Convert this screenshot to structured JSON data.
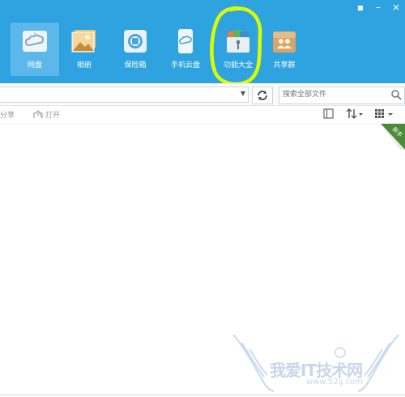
{
  "window": {
    "controls": [
      "pin-icon",
      "minimize-icon",
      "close-icon"
    ]
  },
  "nav": {
    "items": [
      {
        "label": "网盘",
        "icon": "cloud-disk-icon",
        "active": true
      },
      {
        "label": "相册",
        "icon": "photo-album-icon",
        "active": false
      },
      {
        "label": "保险箱",
        "icon": "safe-box-icon",
        "active": false
      },
      {
        "label": "手机云盘",
        "icon": "mobile-cloud-icon",
        "active": false
      },
      {
        "label": "功能大全",
        "icon": "toolbox-icon",
        "active": false
      },
      {
        "label": "共享群",
        "icon": "share-group-icon",
        "active": false
      }
    ]
  },
  "addressbar": {
    "value": ""
  },
  "search": {
    "placeholder": "搜索全部文件"
  },
  "toolbar": {
    "share_label": "分享",
    "open_label": "打开"
  },
  "corner_badge": {
    "label": "新手"
  },
  "watermark": {
    "text": "我爱IT技术网",
    "url": "www.52ij.com"
  },
  "colors": {
    "topbar": "#2fa3e0",
    "active_tab": "#5cb8ea",
    "annotation": "#d8ff00"
  }
}
